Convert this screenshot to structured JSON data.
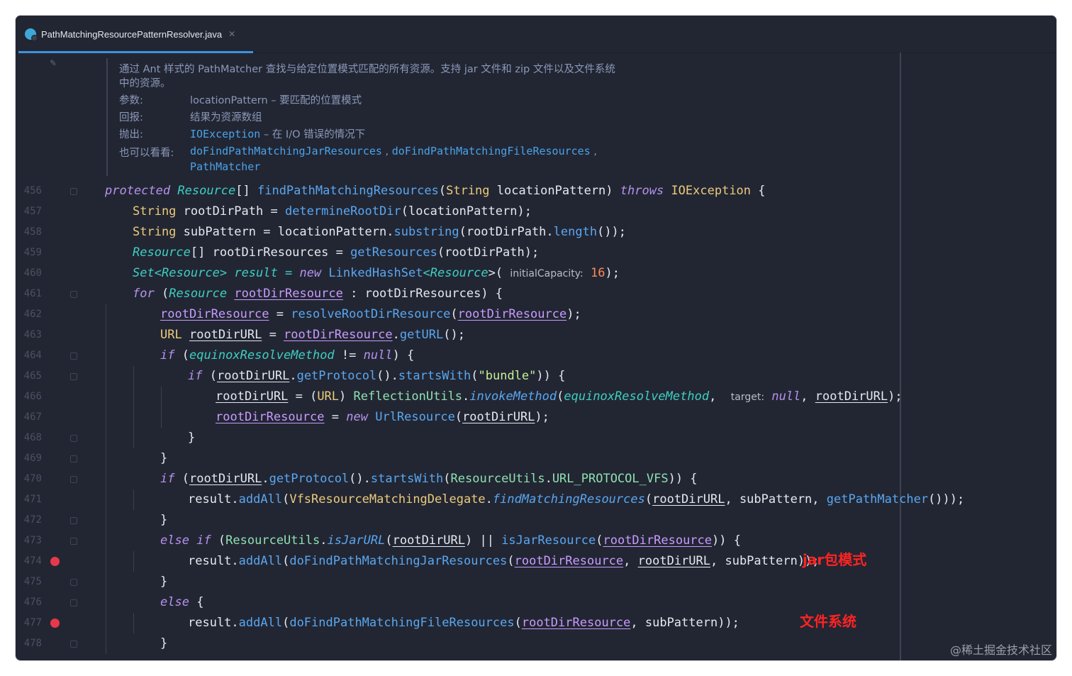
{
  "tab": {
    "title": "PathMatchingResourcePatternResolver.java",
    "close": "✕"
  },
  "doc": {
    "desc1": "通过 Ant 样式的 PathMatcher 查找与给定位置模式匹配的所有资源。支持 jar 文件和 zip 文件以及文件系统",
    "desc2": "中的资源。",
    "params_key": "参数:",
    "params_val": "locationPattern – 要匹配的位置模式",
    "returns_key": "回报:",
    "returns_val": "结果为资源数组",
    "throws_key": "抛出:",
    "throws_type": "IOException",
    "throws_desc": " – 在 I/O 错误的情况下",
    "see_key": "也可以看看:",
    "see_1": "doFindPathMatchingJarResources",
    "see_sep1": " , ",
    "see_2": "doFindPathMatchingFileResources",
    "see_sep2": " ,",
    "see_3": "PathMatcher"
  },
  "line_numbers": [
    "456",
    "457",
    "458",
    "459",
    "460",
    "461",
    "462",
    "463",
    "464",
    "465",
    "466",
    "467",
    "468",
    "469",
    "470",
    "471",
    "472",
    "473",
    "474",
    "475",
    "476",
    "477",
    "478"
  ],
  "breakpoint_lines": [
    "474",
    "477"
  ],
  "code": {
    "l456": [
      "protected",
      " ",
      "Resource",
      "[] ",
      "findPathMatchingResources",
      "(",
      "String",
      " locationPattern) ",
      "throws",
      " ",
      "IOException",
      " {"
    ],
    "l457": [
      "String",
      " rootDirPath = ",
      "determineRootDir",
      "(locationPattern);"
    ],
    "l458": [
      "String",
      " subPattern = locationPattern.",
      "substring",
      "(rootDirPath.",
      "length",
      "());"
    ],
    "l459": [
      "Resource",
      "[] rootDirResources = ",
      "getResources",
      "(rootDirPath);"
    ],
    "l460": [
      "Set",
      "<",
      "Resource",
      "> result = ",
      "new",
      " ",
      "LinkedHashSet",
      "<",
      "Resource",
      ">( ",
      "initialCapacity:",
      " ",
      "16",
      ");"
    ],
    "l461": [
      "for",
      " (",
      "Resource",
      " ",
      "rootDirResource",
      " : rootDirResources) {"
    ],
    "l462": [
      "rootDirResource",
      " = ",
      "resolveRootDirResource",
      "(",
      "rootDirResource",
      ");"
    ],
    "l463": [
      "URL",
      " ",
      "rootDirURL",
      " = ",
      "rootDirResource",
      ".",
      "getURL",
      "();"
    ],
    "l464": [
      "if",
      " (",
      "equinoxResolveMethod",
      " != ",
      "null",
      ") {"
    ],
    "l465": [
      "if",
      " (",
      "rootDirURL",
      ".",
      "getProtocol",
      "().",
      "startsWith",
      "(",
      "\"bundle\"",
      ")) {"
    ],
    "l466": [
      "rootDirURL",
      " = (",
      "URL",
      ") ",
      "ReflectionUtils",
      ".",
      "invokeMethod",
      "(",
      "equinoxResolveMethod",
      ",  ",
      "target:",
      " ",
      "null",
      ", ",
      "rootDirURL",
      ");"
    ],
    "l467": [
      "rootDirResource",
      " = ",
      "new",
      " ",
      "UrlResource",
      "(",
      "rootDirURL",
      ");"
    ],
    "l468": [
      "}"
    ],
    "l469": [
      "}"
    ],
    "l470": [
      "if",
      " (",
      "rootDirURL",
      ".",
      "getProtocol",
      "().",
      "startsWith",
      "(",
      "ResourceUtils",
      ".",
      "URL_PROTOCOL_VFS",
      ")) {"
    ],
    "l471": [
      "result.",
      "addAll",
      "(",
      "VfsResourceMatchingDelegate",
      ".",
      "findMatchingResources",
      "(",
      "rootDirURL",
      ", subPattern, ",
      "getPathMatcher",
      "()));"
    ],
    "l472": [
      "}"
    ],
    "l473": [
      "else",
      " ",
      "if",
      " (",
      "ResourceUtils",
      ".",
      "isJarURL",
      "(",
      "rootDirURL",
      ") || ",
      "isJarResource",
      "(",
      "rootDirResource",
      ")) {"
    ],
    "l474": [
      "result.",
      "addAll",
      "(",
      "doFindPathMatchingJarResources",
      "(",
      "rootDirResource",
      ", ",
      "rootDirURL",
      ", subPattern));"
    ],
    "l475": [
      "}"
    ],
    "l476": [
      "else",
      " {"
    ],
    "l477": [
      "result.",
      "addAll",
      "(",
      "doFindPathMatchingFileResources",
      "(",
      "rootDirResource",
      ", subPattern));"
    ],
    "l478": [
      "}"
    ]
  },
  "annotations": {
    "jar": "jar包模式",
    "file": "文件系统"
  },
  "watermark": "@稀土掘金技术社区",
  "colors": {
    "background": "#222633",
    "keyword": "#b692ec",
    "type": "#ebcb7b",
    "method": "#5aa7f0",
    "breakpoint_line": "#6b131b",
    "annotation": "#ff2323"
  }
}
